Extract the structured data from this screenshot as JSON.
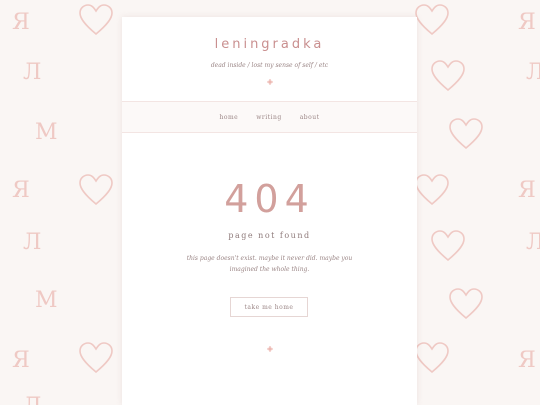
{
  "site": {
    "title": "leningradka",
    "tagline": "dead inside / lost my sense of self / etc"
  },
  "nav": {
    "items": [
      {
        "label": "home"
      },
      {
        "label": "writing"
      },
      {
        "label": "about"
      }
    ]
  },
  "error": {
    "code": "404",
    "title": "page not found",
    "message": "this page doesn't exist. maybe it never did. maybe you imagined the whole thing.",
    "button_label": "take me home"
  },
  "background": {
    "letters": [
      "Я",
      "Л",
      "М"
    ],
    "icon": "heart-outline-icon",
    "color": "#efc9c4"
  },
  "colors": {
    "accent": "#d2a09c",
    "title": "#c98f8f",
    "text": "#9a8585"
  }
}
